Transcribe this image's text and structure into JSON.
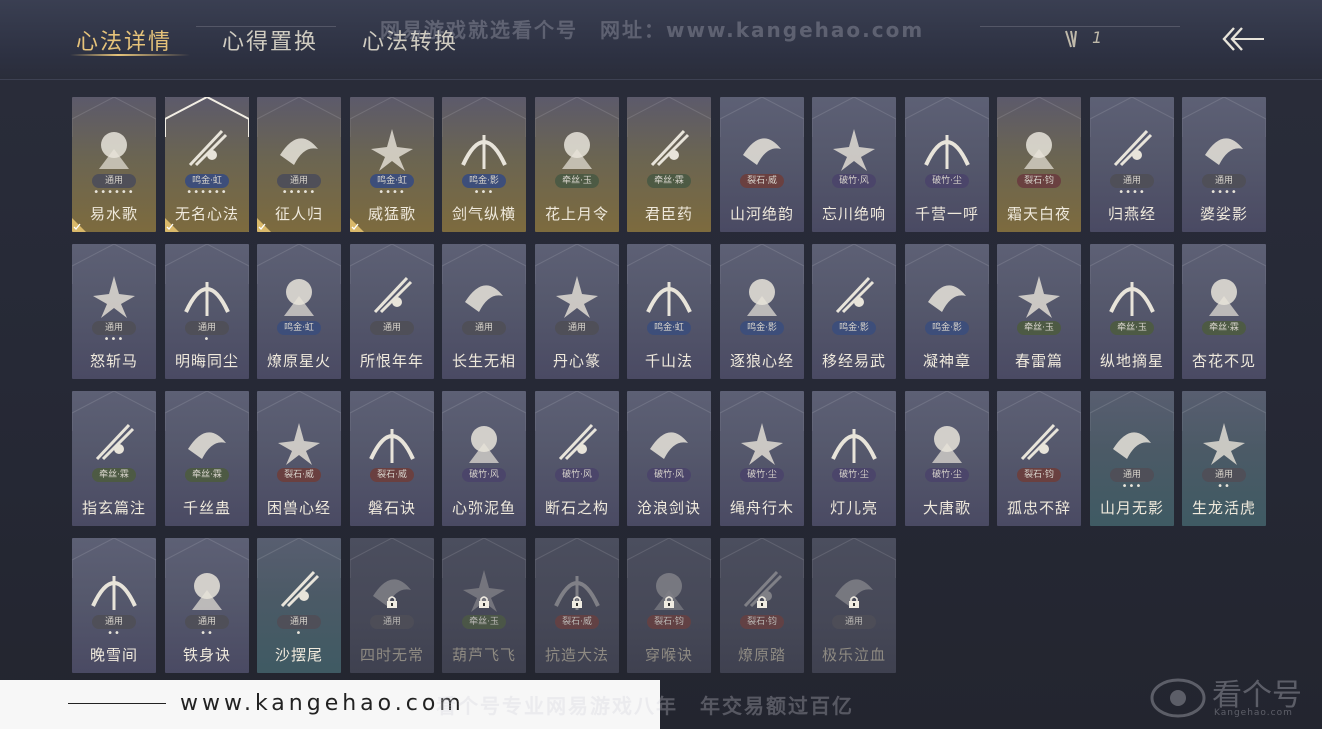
{
  "header": {
    "tabs": [
      {
        "label": "心法详情",
        "active": true
      },
      {
        "label": "心得置换",
        "active": false
      },
      {
        "label": "心法转换",
        "active": false
      }
    ],
    "watermark": "网易游戏就选看个号　网址：www.kangehao.com",
    "count": "1"
  },
  "colors": {
    "accent": "#e6c37a",
    "gold_card": "#7d6b3e",
    "purple_card": "#4a4a63",
    "teal_card": "#3f5a63"
  },
  "cards": [
    {
      "name": "易水歌",
      "tag": "通用",
      "tag_style": "gen",
      "dots": "••••••",
      "theme": "gold",
      "checked": true,
      "icon": "horse-icon"
    },
    {
      "name": "无名心法",
      "tag": "鸣金·虹",
      "tag_style": "blue",
      "dots": "••••••",
      "theme": "gold",
      "checked": true,
      "selected": true,
      "icon": "sword-icon"
    },
    {
      "name": "征人归",
      "tag": "通用",
      "tag_style": "gen",
      "dots": "•••••",
      "theme": "gold",
      "checked": true,
      "icon": "bird-icon"
    },
    {
      "name": "威猛歌",
      "tag": "鸣金·虹",
      "tag_style": "blue",
      "dots": "••••",
      "theme": "gold",
      "checked": true,
      "icon": "fist-icon"
    },
    {
      "name": "剑气纵横",
      "tag": "鸣金·影",
      "tag_style": "blue",
      "dots": "•••",
      "theme": "gold",
      "icon": "swords-icon"
    },
    {
      "name": "花上月令",
      "tag": "牵丝·玉",
      "tag_style": "green",
      "dots": "",
      "theme": "gold",
      "icon": "flower-icon"
    },
    {
      "name": "君臣药",
      "tag": "牵丝·霖",
      "tag_style": "green",
      "dots": "",
      "theme": "gold",
      "icon": "herb-icon"
    },
    {
      "name": "山河绝韵",
      "tag": "裂石·威",
      "tag_style": "red",
      "dots": "",
      "theme": "purple",
      "icon": "mountain-icon"
    },
    {
      "name": "忘川绝响",
      "tag": "破竹·风",
      "tag_style": "purple",
      "dots": "",
      "theme": "purple",
      "icon": "wind-icon"
    },
    {
      "name": "千营一呼",
      "tag": "破竹·尘",
      "tag_style": "purple",
      "dots": "",
      "theme": "purple",
      "icon": "flag-icon"
    },
    {
      "name": "霜天白夜",
      "tag": "裂石·钧",
      "tag_style": "red",
      "dots": "",
      "theme": "gold",
      "icon": "spear-icon"
    },
    {
      "name": "归燕经",
      "tag": "通用",
      "tag_style": "gen",
      "dots": "••••",
      "theme": "purple",
      "icon": "swallow-icon"
    },
    {
      "name": "婆娑影",
      "tag": "通用",
      "tag_style": "gen",
      "dots": "••••",
      "theme": "purple",
      "icon": "dragon-icon"
    },
    {
      "name": "怒斩马",
      "tag": "通用",
      "tag_style": "gen",
      "dots": "•••",
      "theme": "purple",
      "icon": "blade-icon"
    },
    {
      "name": "明晦同尘",
      "tag": "通用",
      "tag_style": "gen",
      "dots": "•",
      "theme": "purple",
      "icon": "snake-icon"
    },
    {
      "name": "燎原星火",
      "tag": "鸣金·虹",
      "tag_style": "blue",
      "dots": "",
      "theme": "purple",
      "icon": "scythe-icon"
    },
    {
      "name": "所恨年年",
      "tag": "通用",
      "tag_style": "gen",
      "dots": "",
      "theme": "purple",
      "icon": "reed-icon"
    },
    {
      "name": "长生无相",
      "tag": "通用",
      "tag_style": "gen",
      "dots": "",
      "theme": "purple",
      "icon": "figure-icon"
    },
    {
      "name": "丹心篆",
      "tag": "通用",
      "tag_style": "gen",
      "dots": "",
      "theme": "purple",
      "icon": "brush-icon"
    },
    {
      "name": "千山法",
      "tag": "鸣金·虹",
      "tag_style": "blue",
      "dots": "",
      "theme": "purple",
      "icon": "peaks-icon"
    },
    {
      "name": "逐狼心经",
      "tag": "鸣金·影",
      "tag_style": "blue",
      "dots": "",
      "theme": "purple",
      "icon": "wolf-icon"
    },
    {
      "name": "移经易武",
      "tag": "鸣金·影",
      "tag_style": "blue",
      "dots": "",
      "theme": "purple",
      "icon": "warrior-icon"
    },
    {
      "name": "凝神章",
      "tag": "鸣金·影",
      "tag_style": "blue",
      "dots": "",
      "theme": "purple",
      "icon": "bow-icon"
    },
    {
      "name": "春雷篇",
      "tag": "牵丝·玉",
      "tag_style": "green",
      "dots": "",
      "theme": "purple",
      "icon": "storm-icon"
    },
    {
      "name": "纵地摘星",
      "tag": "牵丝·玉",
      "tag_style": "green",
      "dots": "",
      "theme": "purple",
      "icon": "swirl-icon"
    },
    {
      "name": "杏花不见",
      "tag": "牵丝·霖",
      "tag_style": "green",
      "dots": "",
      "theme": "purple",
      "icon": "blossom-icon"
    },
    {
      "name": "指玄篇注",
      "tag": "牵丝·霖",
      "tag_style": "green",
      "dots": "",
      "theme": "purple",
      "icon": "yinyang-icon"
    },
    {
      "name": "千丝蛊",
      "tag": "牵丝·霖",
      "tag_style": "green",
      "dots": "",
      "theme": "purple",
      "icon": "leaf-icon"
    },
    {
      "name": "困兽心经",
      "tag": "裂石·威",
      "tag_style": "red",
      "dots": "",
      "theme": "purple",
      "icon": "cage-icon"
    },
    {
      "name": "磐石诀",
      "tag": "裂石·威",
      "tag_style": "red",
      "dots": "",
      "theme": "purple",
      "icon": "rock-icon"
    },
    {
      "name": "心弥泥鱼",
      "tag": "破竹·风",
      "tag_style": "purple",
      "dots": "",
      "theme": "purple",
      "icon": "fish-icon"
    },
    {
      "name": "断石之构",
      "tag": "破竹·风",
      "tag_style": "purple",
      "dots": "",
      "theme": "purple",
      "icon": "hammer-icon"
    },
    {
      "name": "沧浪剑诀",
      "tag": "破竹·风",
      "tag_style": "purple",
      "dots": "",
      "theme": "purple",
      "icon": "seadragon-icon"
    },
    {
      "name": "绳舟行木",
      "tag": "破竹·尘",
      "tag_style": "purple",
      "dots": "",
      "theme": "purple",
      "icon": "vine-icon"
    },
    {
      "name": "灯儿亮",
      "tag": "破竹·尘",
      "tag_style": "purple",
      "dots": "",
      "theme": "purple",
      "icon": "lamp-icon"
    },
    {
      "name": "大唐歌",
      "tag": "破竹·尘",
      "tag_style": "purple",
      "dots": "",
      "theme": "purple",
      "icon": "wall-icon"
    },
    {
      "name": "孤忠不辞",
      "tag": "裂石·钧",
      "tag_style": "red",
      "dots": "",
      "theme": "purple",
      "icon": "crossed-icon"
    },
    {
      "name": "山月无影",
      "tag": "通用",
      "tag_style": "gen",
      "dots": "•••",
      "theme": "teal",
      "icon": "claw-icon"
    },
    {
      "name": "生龙活虎",
      "tag": "通用",
      "tag_style": "gen",
      "dots": "••",
      "theme": "teal",
      "icon": "tiger-icon"
    },
    {
      "name": "晚雪间",
      "tag": "通用",
      "tag_style": "gen",
      "dots": "••",
      "theme": "purple",
      "icon": "cross-icon"
    },
    {
      "name": "铁身诀",
      "tag": "通用",
      "tag_style": "gen",
      "dots": "••",
      "theme": "purple",
      "icon": "muscle-icon"
    },
    {
      "name": "沙摆尾",
      "tag": "通用",
      "tag_style": "gen",
      "dots": "•",
      "theme": "teal",
      "icon": "phoenix-icon"
    },
    {
      "name": "四时无常",
      "tag": "通用",
      "tag_style": "gen",
      "dots": "",
      "theme": "dim",
      "locked": true,
      "icon": "beast-icon"
    },
    {
      "name": "葫芦飞飞",
      "tag": "牵丝·玉",
      "tag_style": "green",
      "dots": "",
      "theme": "dim",
      "locked": true,
      "icon": "gourd-icon"
    },
    {
      "name": "抗造大法",
      "tag": "裂石·威",
      "tag_style": "red",
      "dots": "",
      "theme": "dim",
      "locked": true,
      "icon": "bell-icon"
    },
    {
      "name": "穿喉诀",
      "tag": "裂石·钧",
      "tag_style": "red",
      "dots": "",
      "theme": "dim",
      "locked": true,
      "icon": "skull-icon"
    },
    {
      "name": "燎原踏",
      "tag": "裂石·钧",
      "tag_style": "red",
      "dots": "",
      "theme": "dim",
      "locked": true,
      "icon": "rider-icon"
    },
    {
      "name": "极乐泣血",
      "tag": "通用",
      "tag_style": "gen",
      "dots": "",
      "theme": "dim",
      "locked": true,
      "icon": "wings-icon"
    }
  ],
  "footer": {
    "url": "www.kangehao.com",
    "watermark": "看个号专业网易游戏八年　年交易额过百亿",
    "brand": "看个号",
    "brand_sub": "Kangehao.com"
  }
}
